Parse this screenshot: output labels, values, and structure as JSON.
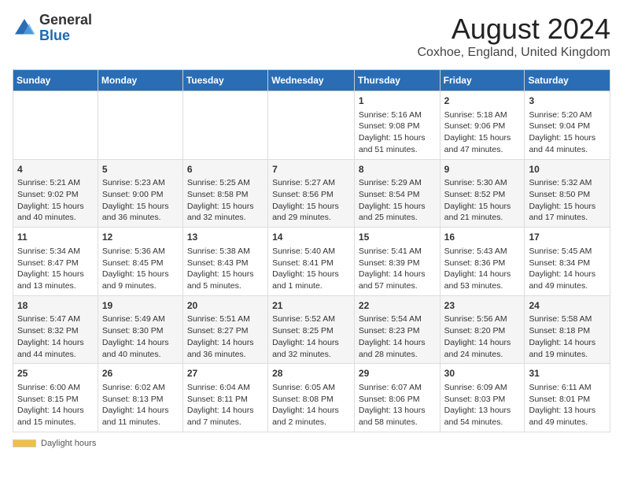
{
  "logo": {
    "general": "General",
    "blue": "Blue"
  },
  "title": "August 2024",
  "location": "Coxhoe, England, United Kingdom",
  "days_of_week": [
    "Sunday",
    "Monday",
    "Tuesday",
    "Wednesday",
    "Thursday",
    "Friday",
    "Saturday"
  ],
  "footer": {
    "daylight_label": "Daylight hours"
  },
  "weeks": [
    [
      {
        "day": "",
        "info": ""
      },
      {
        "day": "",
        "info": ""
      },
      {
        "day": "",
        "info": ""
      },
      {
        "day": "",
        "info": ""
      },
      {
        "day": "1",
        "info": "Sunrise: 5:16 AM\nSunset: 9:08 PM\nDaylight: 15 hours and 51 minutes."
      },
      {
        "day": "2",
        "info": "Sunrise: 5:18 AM\nSunset: 9:06 PM\nDaylight: 15 hours and 47 minutes."
      },
      {
        "day": "3",
        "info": "Sunrise: 5:20 AM\nSunset: 9:04 PM\nDaylight: 15 hours and 44 minutes."
      }
    ],
    [
      {
        "day": "4",
        "info": "Sunrise: 5:21 AM\nSunset: 9:02 PM\nDaylight: 15 hours and 40 minutes."
      },
      {
        "day": "5",
        "info": "Sunrise: 5:23 AM\nSunset: 9:00 PM\nDaylight: 15 hours and 36 minutes."
      },
      {
        "day": "6",
        "info": "Sunrise: 5:25 AM\nSunset: 8:58 PM\nDaylight: 15 hours and 32 minutes."
      },
      {
        "day": "7",
        "info": "Sunrise: 5:27 AM\nSunset: 8:56 PM\nDaylight: 15 hours and 29 minutes."
      },
      {
        "day": "8",
        "info": "Sunrise: 5:29 AM\nSunset: 8:54 PM\nDaylight: 15 hours and 25 minutes."
      },
      {
        "day": "9",
        "info": "Sunrise: 5:30 AM\nSunset: 8:52 PM\nDaylight: 15 hours and 21 minutes."
      },
      {
        "day": "10",
        "info": "Sunrise: 5:32 AM\nSunset: 8:50 PM\nDaylight: 15 hours and 17 minutes."
      }
    ],
    [
      {
        "day": "11",
        "info": "Sunrise: 5:34 AM\nSunset: 8:47 PM\nDaylight: 15 hours and 13 minutes."
      },
      {
        "day": "12",
        "info": "Sunrise: 5:36 AM\nSunset: 8:45 PM\nDaylight: 15 hours and 9 minutes."
      },
      {
        "day": "13",
        "info": "Sunrise: 5:38 AM\nSunset: 8:43 PM\nDaylight: 15 hours and 5 minutes."
      },
      {
        "day": "14",
        "info": "Sunrise: 5:40 AM\nSunset: 8:41 PM\nDaylight: 15 hours and 1 minute."
      },
      {
        "day": "15",
        "info": "Sunrise: 5:41 AM\nSunset: 8:39 PM\nDaylight: 14 hours and 57 minutes."
      },
      {
        "day": "16",
        "info": "Sunrise: 5:43 AM\nSunset: 8:36 PM\nDaylight: 14 hours and 53 minutes."
      },
      {
        "day": "17",
        "info": "Sunrise: 5:45 AM\nSunset: 8:34 PM\nDaylight: 14 hours and 49 minutes."
      }
    ],
    [
      {
        "day": "18",
        "info": "Sunrise: 5:47 AM\nSunset: 8:32 PM\nDaylight: 14 hours and 44 minutes."
      },
      {
        "day": "19",
        "info": "Sunrise: 5:49 AM\nSunset: 8:30 PM\nDaylight: 14 hours and 40 minutes."
      },
      {
        "day": "20",
        "info": "Sunrise: 5:51 AM\nSunset: 8:27 PM\nDaylight: 14 hours and 36 minutes."
      },
      {
        "day": "21",
        "info": "Sunrise: 5:52 AM\nSunset: 8:25 PM\nDaylight: 14 hours and 32 minutes."
      },
      {
        "day": "22",
        "info": "Sunrise: 5:54 AM\nSunset: 8:23 PM\nDaylight: 14 hours and 28 minutes."
      },
      {
        "day": "23",
        "info": "Sunrise: 5:56 AM\nSunset: 8:20 PM\nDaylight: 14 hours and 24 minutes."
      },
      {
        "day": "24",
        "info": "Sunrise: 5:58 AM\nSunset: 8:18 PM\nDaylight: 14 hours and 19 minutes."
      }
    ],
    [
      {
        "day": "25",
        "info": "Sunrise: 6:00 AM\nSunset: 8:15 PM\nDaylight: 14 hours and 15 minutes."
      },
      {
        "day": "26",
        "info": "Sunrise: 6:02 AM\nSunset: 8:13 PM\nDaylight: 14 hours and 11 minutes."
      },
      {
        "day": "27",
        "info": "Sunrise: 6:04 AM\nSunset: 8:11 PM\nDaylight: 14 hours and 7 minutes."
      },
      {
        "day": "28",
        "info": "Sunrise: 6:05 AM\nSunset: 8:08 PM\nDaylight: 14 hours and 2 minutes."
      },
      {
        "day": "29",
        "info": "Sunrise: 6:07 AM\nSunset: 8:06 PM\nDaylight: 13 hours and 58 minutes."
      },
      {
        "day": "30",
        "info": "Sunrise: 6:09 AM\nSunset: 8:03 PM\nDaylight: 13 hours and 54 minutes."
      },
      {
        "day": "31",
        "info": "Sunrise: 6:11 AM\nSunset: 8:01 PM\nDaylight: 13 hours and 49 minutes."
      }
    ]
  ]
}
